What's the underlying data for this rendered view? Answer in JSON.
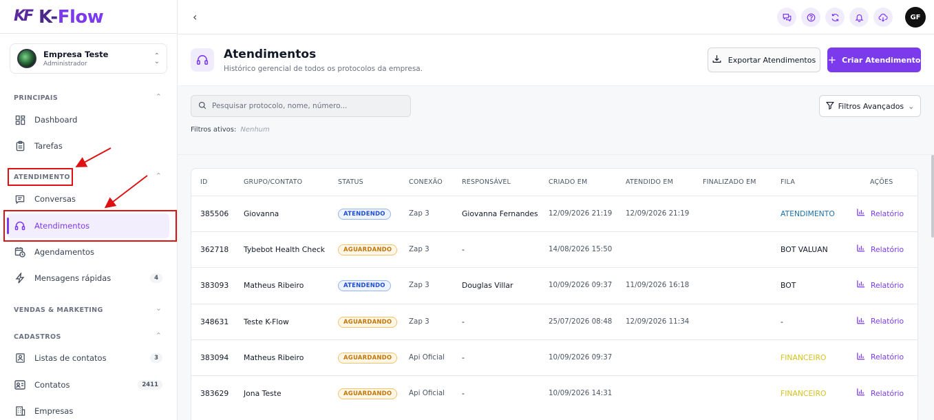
{
  "app": {
    "name_part1": "K-",
    "name_part2": "Flow",
    "mark": "KF"
  },
  "company": {
    "name": "Empresa Teste",
    "role": "Administrador"
  },
  "sidebar": {
    "sections": [
      {
        "label": "PRINCIPAIS"
      },
      {
        "label": "ATENDIMENTO"
      },
      {
        "label": "VENDAS & MARKETING"
      },
      {
        "label": "CADASTROS"
      }
    ],
    "items": [
      {
        "label": "Dashboard",
        "icon": "dashboard-icon"
      },
      {
        "label": "Tarefas",
        "icon": "clipboard-icon"
      },
      {
        "label": "Conversas",
        "icon": "chat-icon"
      },
      {
        "label": "Atendimentos",
        "icon": "headset-icon",
        "active": true
      },
      {
        "label": "Agendamentos",
        "icon": "calendar-clock-icon"
      },
      {
        "label": "Mensagens rápidas",
        "icon": "lightning-icon",
        "badge": "4"
      },
      {
        "label": "Listas de contatos",
        "icon": "contact-list-icon",
        "badge": "3"
      },
      {
        "label": "Contatos",
        "icon": "contact-card-icon",
        "badge": "2411"
      },
      {
        "label": "Empresas",
        "icon": "building-icon"
      }
    ]
  },
  "topbar": {
    "user_initials": "GF"
  },
  "page": {
    "title": "Atendimentos",
    "subtitle": "Histórico gerencial de todos os protocolos da empresa.",
    "export_label": "Exportar Atendimentos",
    "create_label": "Criar Atendimento"
  },
  "filters": {
    "search_placeholder": "Pesquisar protocolo, nome, número...",
    "advanced_label": "Filtros Avançados",
    "active_label": "Filtros ativos:",
    "active_value": "Nenhum"
  },
  "table": {
    "headers": [
      "ID",
      "GRUPO/CONTATO",
      "STATUS",
      "CONEXÃO",
      "RESPONSÁVEL",
      "CRIADO EM",
      "ATENDIDO EM",
      "FINALIZADO EM",
      "FILA",
      "AÇÕES"
    ],
    "action_label": "Relatório",
    "rows": [
      {
        "id": "385506",
        "contact": "Giovanna",
        "status": "ATENDENDO",
        "connection": "Zap 3",
        "responsible": "Giovanna Fernandes",
        "created": "12/09/2026 21:19",
        "attended": "12/09/2026 21:19",
        "finished": "",
        "queue": "ATENDIMENTO",
        "queue_color": "#1d6fa8"
      },
      {
        "id": "362718",
        "contact": "Tybebot Health Check",
        "status": "AGUARDANDO",
        "connection": "Zap 3",
        "responsible": "-",
        "created": "14/08/2026 15:50",
        "attended": "",
        "finished": "",
        "queue": "BOT VALUAN",
        "queue_color": "#111827"
      },
      {
        "id": "383093",
        "contact": "Matheus Ribeiro",
        "status": "ATENDENDO",
        "connection": "Zap 3",
        "responsible": "Douglas Villar",
        "created": "10/09/2026 09:37",
        "attended": "11/09/2026 16:18",
        "finished": "",
        "queue": "BOT",
        "queue_color": "#111827"
      },
      {
        "id": "348631",
        "contact": "Teste K-Flow",
        "status": "AGUARDANDO",
        "connection": "Zap 3",
        "responsible": "-",
        "created": "25/07/2026 08:48",
        "attended": "12/09/2026 11:34",
        "finished": "",
        "queue": "-",
        "queue_color": "#111827"
      },
      {
        "id": "383094",
        "contact": "Matheus Ribeiro",
        "status": "AGUARDANDO",
        "connection": "Api Oficial",
        "responsible": "-",
        "created": "10/09/2026 09:37",
        "attended": "",
        "finished": "",
        "queue": "FINANCEIRO",
        "queue_color": "#d4c21a"
      },
      {
        "id": "383629",
        "contact": "Jona Teste",
        "status": "AGUARDANDO",
        "connection": "Api Oficial",
        "responsible": "-",
        "created": "10/09/2026 14:31",
        "attended": "",
        "finished": "",
        "queue": "FINANCEIRO",
        "queue_color": "#d4c21a"
      }
    ]
  },
  "colors": {
    "accent": "#7c3aed",
    "annotation": "#dd1111"
  }
}
